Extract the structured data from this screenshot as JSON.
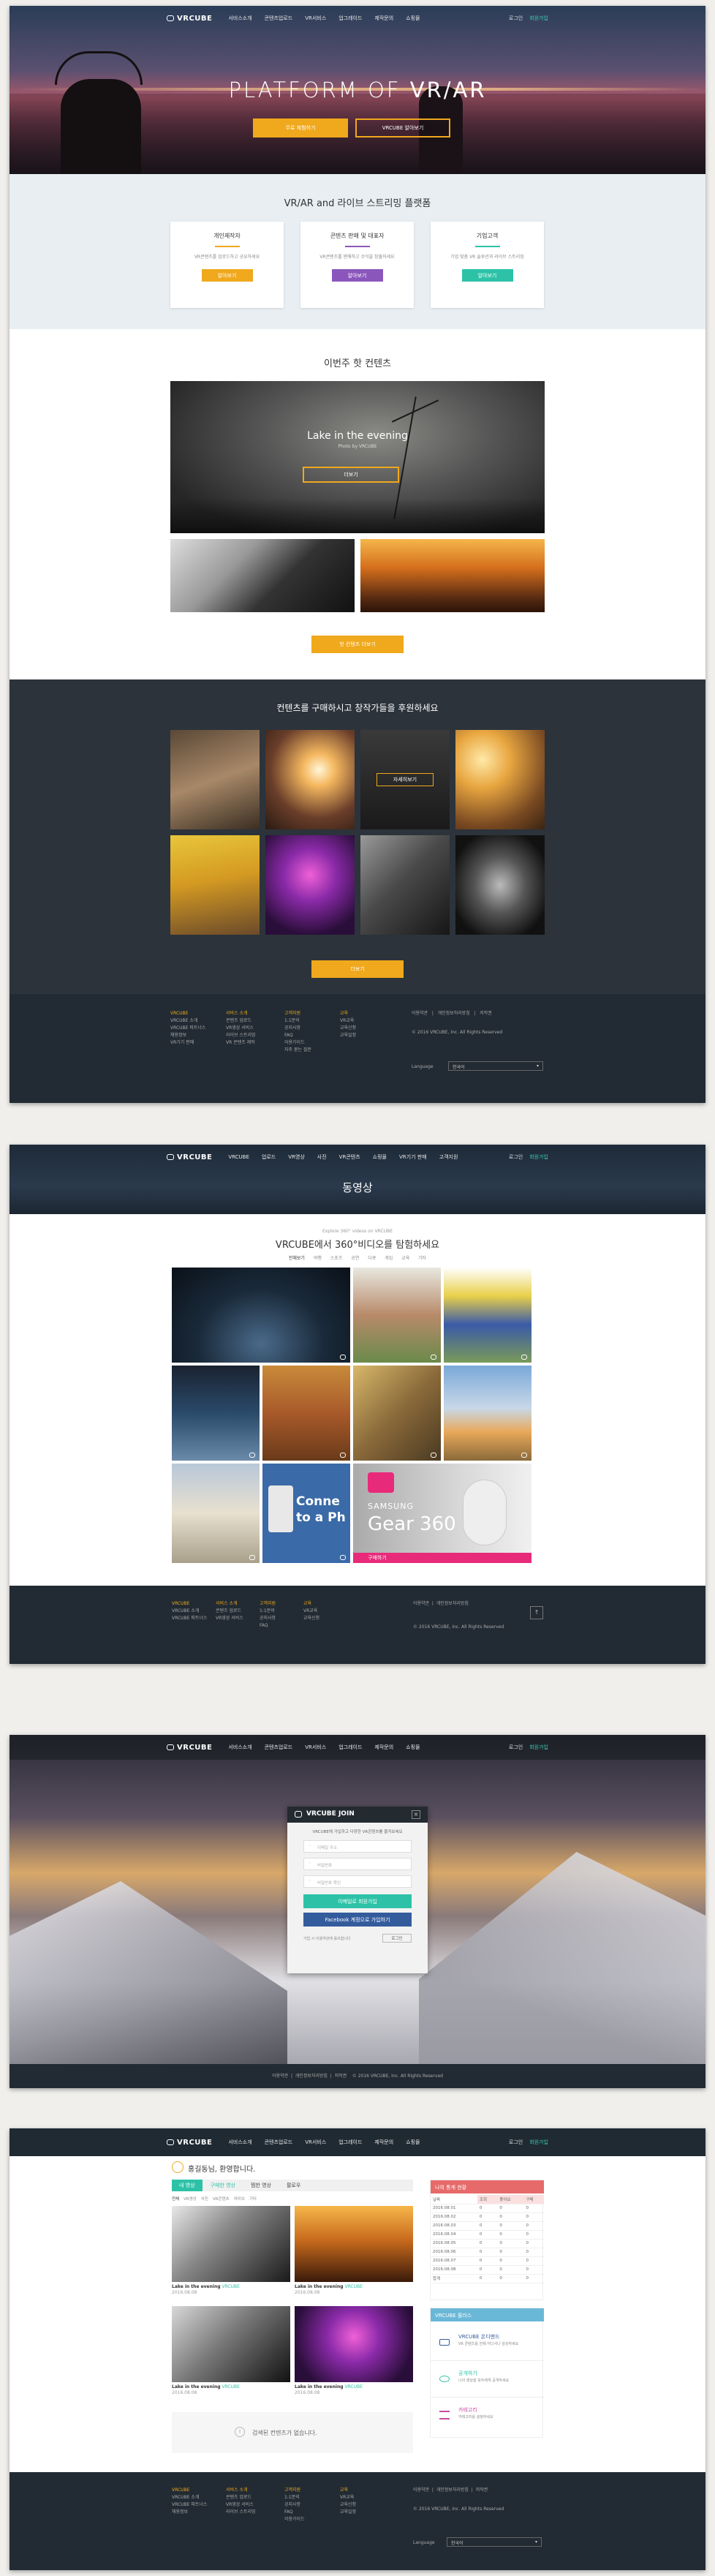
{
  "nav": {
    "brand": "VRCUBE",
    "items": [
      "서비스소개",
      "콘텐츠업로드",
      "VR서비스",
      "업그레이드",
      "제작문의",
      "쇼핑몰"
    ],
    "login": "로그인",
    "signup": "회원가입"
  },
  "nav2": {
    "items": [
      "VRCUBE",
      "업로드",
      "VR영상",
      "사진",
      "VR콘텐츠",
      "쇼핑몰",
      "VR기기 판매",
      "고객지원"
    ],
    "login": "로그인",
    "signup": "회원가입"
  },
  "home": {
    "hero_title_prefix": "PLATFORM OF ",
    "hero_title_bold": "VR/AR",
    "hero_btn1": "무료 체험하기",
    "hero_btn2": "VRCUBE 알아보기",
    "platform_title": "VR/AR and 라이브 스트리밍 플랫폼",
    "cards": [
      {
        "title": "개인제작자",
        "desc": "VR콘텐츠를 업로드하고 공유하세요",
        "btn": "알아보기"
      },
      {
        "title": "콘텐츠 판매 및 대표자",
        "desc": "VR콘텐츠를 판매하고 수익을 창출하세요",
        "btn": "알아보기"
      },
      {
        "title": "기업고객",
        "desc": "기업 맞춤 VR 솔루션과 라이브 스트리밍",
        "btn": "알아보기"
      }
    ],
    "weekly_title": "이번주 핫 컨텐츠",
    "feature_title": "Lake in the evening",
    "feature_sub": "Photo by VRCUBE",
    "feature_btn": "더보기",
    "more_btn": "핫 컨텐츠 더보기",
    "support_title": "컨텐츠를 구매하시고 창작가들을 후원하세요",
    "overlay_btn": "자세히보기",
    "support_more": "더보기"
  },
  "footer": {
    "cols": [
      {
        "head": "VRCUBE",
        "items": [
          "VRCUBE 소개",
          "VRCUBE 파트너스",
          "채용정보",
          "VR기기 판매"
        ]
      },
      {
        "head": "서비스 소개",
        "items": [
          "콘텐츠 업로드",
          "VR영상 서비스",
          "라이브 스트리밍",
          "VR 콘텐츠 제작"
        ]
      },
      {
        "head": "고객지원",
        "items": [
          "1:1문의",
          "공지사항",
          "FAQ",
          "이용가이드",
          "자주 묻는 질문"
        ]
      },
      {
        "head": "교육",
        "items": [
          "VR교육",
          "교육신청",
          "교육일정"
        ]
      }
    ],
    "right_links": [
      "이용약관",
      "개인정보처리방침",
      "저작권"
    ],
    "copyright": "© 2016 VRCUBE, Inc. All Rights Reserved",
    "language_label": "Language",
    "language_value": "한국어"
  },
  "video": {
    "page_title": "동영상",
    "sub_small": "Explore 360° videos on VRCUBE",
    "heading": "VRCUBE에서 360°비디오를 탐험하세요",
    "filters": [
      "전체보기",
      "여행",
      "스포츠",
      "공연",
      "다큐",
      "게임",
      "교육",
      "기타"
    ],
    "promo_brand": "SAMSUNG",
    "promo_product": "Gear 360",
    "promo_bar": "구매하기",
    "connect_text1": "Conne",
    "connect_text2": "to a Ph"
  },
  "join": {
    "title": "VRCUBE JOIN",
    "desc": "VRCUBE에 가입하고 다양한 VR콘텐츠를 즐겨보세요",
    "field1": "이메일 주소",
    "field2": "비밀번호",
    "field3": "비밀번호 확인",
    "submit": "이메일로 회원가입",
    "facebook": "Facebook 계정으로 가입하기",
    "terms": "가입 시 이용약관에 동의합니다",
    "login_link": "로그인",
    "bottom_links": [
      "이용약관",
      "개인정보처리방침",
      "저작권"
    ]
  },
  "mypage": {
    "greeting": "홍길동님, 환영합니다.",
    "tabs": [
      "내 영상",
      "구매한 영상",
      "찜한 영상",
      "팔로우"
    ],
    "filters": [
      "전체",
      "VR영상",
      "사진",
      "VR콘텐츠",
      "라이브",
      "기타"
    ],
    "items": [
      {
        "title": "Lake in the evening",
        "by": "VRCUBE",
        "date": "2016.08.08"
      },
      {
        "title": "Lake in the evening",
        "by": "VRCUBE",
        "date": "2016.08.08"
      },
      {
        "title": "Lake in the evening",
        "by": "VRCUBE",
        "date": "2016.08.08"
      },
      {
        "title": "Lake in the evening",
        "by": "VRCUBE",
        "date": "2016.08.08"
      }
    ],
    "empty_msg": "검색된 컨텐츠가 없습니다.",
    "stats_title": "나의 통계 현황",
    "stats_headers": [
      "날짜",
      "조회",
      "좋아요",
      "구매"
    ],
    "stats_rows": [
      [
        "2016.08.01",
        "0",
        "0",
        "0"
      ],
      [
        "2016.08.02",
        "0",
        "0",
        "0"
      ],
      [
        "2016.08.03",
        "0",
        "0",
        "0"
      ],
      [
        "2016.08.04",
        "0",
        "0",
        "0"
      ],
      [
        "2016.08.05",
        "0",
        "0",
        "0"
      ],
      [
        "2016.08.06",
        "0",
        "0",
        "0"
      ],
      [
        "2016.08.07",
        "0",
        "0",
        "0"
      ],
      [
        "2016.08.08",
        "0",
        "0",
        "0"
      ],
      [
        "합계",
        "0",
        "0",
        "0"
      ]
    ],
    "promo_title": "VRCUBE 플러스",
    "promos": [
      {
        "title": "VRCUBE 온디맨드",
        "desc": "VR 콘텐츠를 언제 어디서나 감상하세요"
      },
      {
        "title": "공개하기",
        "desc": "나의 영상을 모두에게 공개하세요"
      },
      {
        "title": "카테고리",
        "desc": "카테고리를 설정하세요"
      }
    ]
  }
}
